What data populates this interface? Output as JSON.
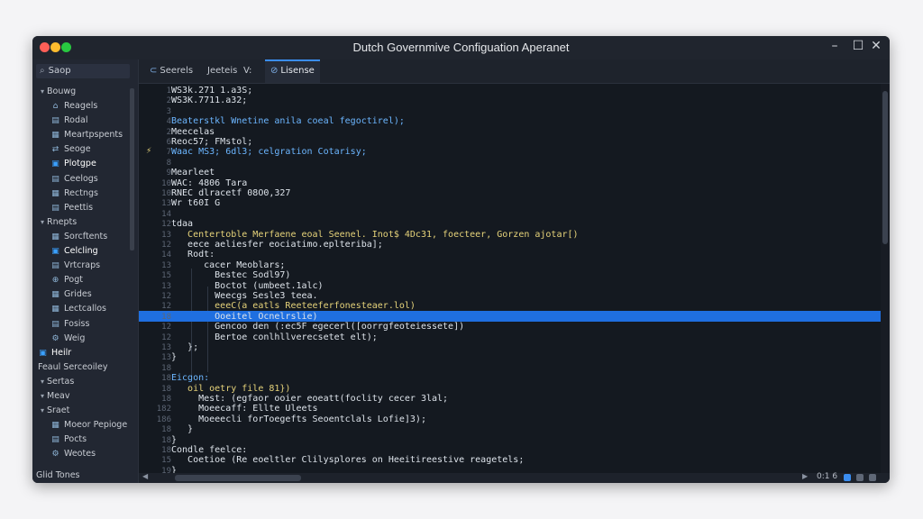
{
  "window": {
    "title": "Dutch Governmive Configuation Aperanet"
  },
  "sidebar": {
    "search_label": "Saop",
    "items": [
      {
        "label": "Bouwg",
        "level": 0,
        "chev": "v"
      },
      {
        "label": "Reagels",
        "level": 1,
        "icon": "⌂"
      },
      {
        "label": "Rodal",
        "level": 1,
        "icon": "▤"
      },
      {
        "label": "Meartpspents",
        "level": 1,
        "icon": "▦"
      },
      {
        "label": "Seoge",
        "level": 1,
        "icon": "⇄"
      },
      {
        "label": "Plotgpe",
        "level": 1,
        "icon": "▣",
        "selected": true
      },
      {
        "label": "Ceelogs",
        "level": 1,
        "icon": "▤"
      },
      {
        "label": "Rectngs",
        "level": 1,
        "icon": "▦"
      },
      {
        "label": "Peettis",
        "level": 1,
        "icon": "▤"
      },
      {
        "label": "Rnepts",
        "level": 0,
        "chev": "v"
      },
      {
        "label": "Sorcftents",
        "level": 1,
        "icon": "▦"
      },
      {
        "label": "Celcling",
        "level": 1,
        "icon": "▣",
        "selected": true
      },
      {
        "label": "Vrtcraps",
        "level": 1,
        "icon": "▤"
      },
      {
        "label": "Pogt",
        "level": 1,
        "icon": "⊕"
      },
      {
        "label": "Grides",
        "level": 1,
        "icon": "▦"
      },
      {
        "label": "Lectcallos",
        "level": 1,
        "icon": "▦"
      },
      {
        "label": "Fosiss",
        "level": 1,
        "icon": "▤"
      },
      {
        "label": "Weig",
        "level": 1,
        "icon": "⚙"
      },
      {
        "label": "Heilr",
        "level": 0,
        "icon": "▣",
        "selected": true
      },
      {
        "label": "Feaul Serceoiley",
        "level": 0
      },
      {
        "label": "Sertas",
        "level": 0,
        "chev": "v"
      },
      {
        "label": "Meav",
        "level": 0,
        "chev": "v"
      },
      {
        "label": "Sraet",
        "level": 0,
        "chev": "v"
      },
      {
        "label": "Moeor Pepioge",
        "level": 1,
        "icon": "▦"
      },
      {
        "label": "Pocts",
        "level": 1,
        "icon": "▤"
      },
      {
        "label": "Weotes",
        "level": 1,
        "icon": "⚙"
      }
    ],
    "bottom_label": "Glid Tones"
  },
  "tabs": [
    {
      "label": "Seerels",
      "icon": "⊂"
    },
    {
      "label": "Jeeteis",
      "icon": ""
    },
    {
      "label": "V:",
      "icon": ""
    },
    {
      "label": "Lisense",
      "icon": "⊘",
      "active": true
    }
  ],
  "editor": {
    "lines": [
      {
        "n": "1",
        "text": "WS3k.271 1.a3S;",
        "color": "default"
      },
      {
        "n": "2",
        "text": "WS3K.7711.a32;",
        "color": "default"
      },
      {
        "n": "3",
        "text": "",
        "color": "default"
      },
      {
        "n": "4",
        "text": "Beaterstkl Wnetine anila coeal fegoctirel);",
        "color": "blue"
      },
      {
        "n": "2",
        "text": "Meecelas",
        "color": "default"
      },
      {
        "n": "6",
        "text": "Reoc57; FMstol;",
        "color": "default"
      },
      {
        "n": "7",
        "text": "Waac MS3; 6dl3; celgration Cotarisy;",
        "color": "blue"
      },
      {
        "n": "8",
        "text": "",
        "color": "default"
      },
      {
        "n": "9",
        "text": "Mearleet",
        "color": "default"
      },
      {
        "n": "10",
        "text": "WAC: 4806 Tara",
        "color": "default"
      },
      {
        "n": "10",
        "text": "RNEC dlracetf 08O0,327",
        "color": "default"
      },
      {
        "n": "13",
        "text": "Wr t60I G",
        "color": "default"
      },
      {
        "n": "14",
        "text": "",
        "color": "default"
      },
      {
        "n": "12",
        "text": "tdaa",
        "color": "default"
      },
      {
        "n": "13",
        "text": "   Centertoble Merfaene eoal Seenel. Inot$ 4Dc31, foecteer, Gorzen ajotar[)",
        "color": "yellow"
      },
      {
        "n": "12",
        "text": "   eece aeliesfer eociatimo.eplteriba];",
        "color": "default"
      },
      {
        "n": "14",
        "text": "   Rodt:",
        "color": "default"
      },
      {
        "n": "13",
        "text": "      cacer Meoblars;",
        "color": "default"
      },
      {
        "n": "15",
        "text": "        Bestec Sodl97)",
        "color": "default"
      },
      {
        "n": "13",
        "text": "        Boctot (umbeet.1alc)",
        "color": "default"
      },
      {
        "n": "12",
        "text": "        Weecgs Sesle3 teea.",
        "color": "default"
      },
      {
        "n": "12",
        "text": "        eeeC(a eatls Reeteeferfonesteaer.lol)",
        "color": "yellow"
      },
      {
        "n": "18",
        "text": "        Ooeitel Ocnelrslie)",
        "color": "default",
        "highlight": true
      },
      {
        "n": "12",
        "text": "        Gencoo den (:ec5F egecerl([oorrgfeoteiessete])",
        "color": "default"
      },
      {
        "n": "12",
        "text": "        Bertoe conlhllverecsetet elt);",
        "color": "default"
      },
      {
        "n": "13",
        "text": "   };",
        "color": "default"
      },
      {
        "n": "13",
        "text": "}",
        "color": "default"
      },
      {
        "n": "18",
        "text": "",
        "color": "default"
      },
      {
        "n": "18",
        "text": "Eicgon:",
        "color": "blue"
      },
      {
        "n": "18",
        "text": "   oil oetry file 81})",
        "color": "yellow"
      },
      {
        "n": "18",
        "text": "     Mest: (egfaor ooier eoeatt(foclity cecer 3lal;",
        "color": "default"
      },
      {
        "n": "182",
        "text": "     Moeecaff: Ellte Uleets",
        "color": "default"
      },
      {
        "n": "186",
        "text": "     Moeeecli forToegefts Seoentclals Lofie]3);",
        "color": "default"
      },
      {
        "n": "18",
        "text": "   }",
        "color": "default"
      },
      {
        "n": "18",
        "text": "}",
        "color": "default"
      },
      {
        "n": "18",
        "text": "Condle feelce:",
        "color": "default"
      },
      {
        "n": "15",
        "text": "   Coetioe (Re eoeltler Clilysplores on Heeitireestive reagetels;",
        "color": "default"
      },
      {
        "n": "19",
        "text": "}",
        "color": "default"
      }
    ]
  },
  "statusbar": {
    "text": "0:1 6"
  },
  "colors": {
    "accent": "#1f6fe0",
    "bg": "#141920",
    "sidebar": "#222732"
  }
}
